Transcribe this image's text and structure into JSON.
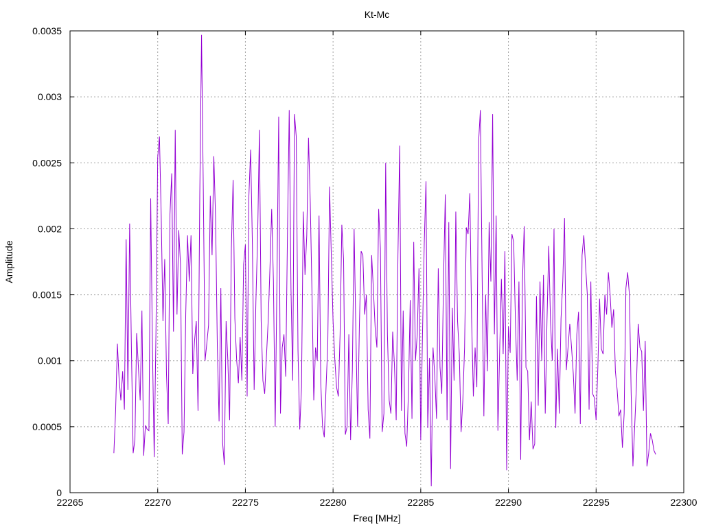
{
  "chart_data": {
    "type": "line",
    "title": "Kt-Mc",
    "xlabel": "Freq [MHz]",
    "ylabel": "Amplitude",
    "xlim": [
      22265,
      22300
    ],
    "ylim": [
      0,
      0.0035
    ],
    "x_ticks": [
      22265,
      22270,
      22275,
      22280,
      22285,
      22290,
      22295,
      22300
    ],
    "y_ticks": [
      0,
      0.0005,
      0.001,
      0.0015,
      0.002,
      0.0025,
      0.003,
      0.0035
    ],
    "x_tick_labels": [
      "22265",
      "22270",
      "22275",
      "22280",
      "22285",
      "22290",
      "22295",
      "22300"
    ],
    "y_tick_labels": [
      "0",
      "0.0005",
      "0.001",
      "0.0015",
      "0.002",
      "0.0025",
      "0.003",
      "0.0035"
    ],
    "grid": true,
    "series": [
      {
        "color": "#9400d3",
        "x_start": 22267.5,
        "x_step": 0.1,
        "values": [
          0.0003,
          0.00062,
          0.00113,
          0.00086,
          0.0007,
          0.00092,
          0.00063,
          0.00192,
          0.00078,
          0.00204,
          0.0011,
          0.0003,
          0.0004,
          0.00121,
          0.00095,
          0.0007,
          0.00138,
          0.00028,
          0.00051,
          0.00048,
          0.00047,
          0.00223,
          0.0011,
          0.00027,
          0.0012,
          0.00254,
          0.0027,
          0.0021,
          0.0013,
          0.00177,
          0.0009,
          0.00052,
          0.00211,
          0.00242,
          0.00122,
          0.00275,
          0.00135,
          0.00199,
          0.00173,
          0.00029,
          0.00046,
          0.00136,
          0.00195,
          0.0016,
          0.00195,
          0.0009,
          0.00115,
          0.0013,
          0.00062,
          0.00226,
          0.00347,
          0.0023,
          0.001,
          0.00113,
          0.00127,
          0.00225,
          0.0018,
          0.00255,
          0.00208,
          0.00111,
          0.00054,
          0.00155,
          0.00038,
          0.00021,
          0.0013,
          0.001,
          0.00055,
          0.00185,
          0.00237,
          0.00132,
          0.00101,
          0.00083,
          0.00118,
          0.00085,
          0.00173,
          0.00188,
          0.00073,
          0.00225,
          0.0026,
          0.00188,
          0.00078,
          0.00145,
          0.00195,
          0.00275,
          0.0013,
          0.00085,
          0.00075,
          0.00103,
          0.0013,
          0.0017,
          0.00215,
          0.0016,
          0.0005,
          0.0016,
          0.00285,
          0.0006,
          0.0011,
          0.0012,
          0.00088,
          0.00196,
          0.0029,
          0.00155,
          0.00085,
          0.00287,
          0.0027,
          0.00108,
          0.00048,
          0.0008,
          0.00213,
          0.00165,
          0.00195,
          0.00269,
          0.0022,
          0.0015,
          0.0007,
          0.0011,
          0.001,
          0.0021,
          0.00083,
          0.0005,
          0.00042,
          0.0008,
          0.00113,
          0.00232,
          0.0018,
          0.0013,
          0.00101,
          0.0008,
          0.00073,
          0.0012,
          0.00203,
          0.00177,
          0.00044,
          0.0005,
          0.0012,
          0.0004,
          0.00093,
          0.002,
          0.00123,
          0.0005,
          0.00126,
          0.00183,
          0.0018,
          0.00135,
          0.0015,
          0.00063,
          0.00041,
          0.0018,
          0.00154,
          0.00125,
          0.0011,
          0.00215,
          0.00185,
          0.00046,
          0.0006,
          0.0025,
          0.0012,
          0.0007,
          0.0006,
          0.00122,
          0.00097,
          0.00055,
          0.0018,
          0.00263,
          0.00062,
          0.00138,
          0.00045,
          0.00035,
          0.00077,
          0.00146,
          0.00056,
          0.0019,
          0.001,
          0.0012,
          0.0017,
          0.0004,
          0.0012,
          0.00189,
          0.00236,
          0.00049,
          0.00102,
          5e-05,
          0.0011,
          0.00089,
          0.00056,
          0.0017,
          0.00095,
          0.00075,
          0.00162,
          0.00226,
          0.00055,
          0.00205,
          0.00018,
          0.0014,
          0.00085,
          0.00213,
          0.0013,
          0.00105,
          0.00046,
          0.0007,
          0.0011,
          0.00201,
          0.00196,
          0.00227,
          0.00132,
          0.00073,
          0.0011,
          0.0008,
          0.00266,
          0.0029,
          0.00165,
          0.00058,
          0.0015,
          0.00092,
          0.00205,
          0.0016,
          0.00287,
          0.0012,
          0.0021,
          0.00047,
          0.00107,
          0.00162,
          0.00105,
          0.00183,
          0.00017,
          0.00126,
          0.00106,
          0.00196,
          0.0019,
          0.0013,
          0.00085,
          0.0016,
          0.00025,
          0.0016,
          0.00202,
          0.00095,
          0.00092,
          0.0004,
          0.00069,
          0.00033,
          0.00037,
          0.00149,
          0.00066,
          0.0016,
          0.001,
          0.00165,
          0.0006,
          0.00131,
          0.00187,
          0.0013,
          0.001,
          0.002,
          0.00049,
          0.00109,
          0.0006,
          0.00132,
          0.0016,
          0.00208,
          0.00093,
          0.0011,
          0.00128,
          0.0011,
          0.0009,
          0.0006,
          0.0012,
          0.00137,
          0.00052,
          0.0018,
          0.00195,
          0.00172,
          0.0015,
          0.00063,
          0.0016,
          0.00075,
          0.00072,
          0.00055,
          0.00095,
          0.00147,
          0.00109,
          0.00105,
          0.0015,
          0.00135,
          0.00167,
          0.0015,
          0.00125,
          0.00139,
          0.00092,
          0.00078,
          0.00058,
          0.00063,
          0.00034,
          0.0006,
          0.00155,
          0.00167,
          0.0015,
          0.00075,
          0.0002,
          0.0005,
          0.00081,
          0.00128,
          0.0011,
          0.00107,
          0.00062,
          0.00115,
          0.0002,
          0.0003,
          0.00045,
          0.0004,
          0.00032,
          0.00029
        ]
      }
    ]
  }
}
